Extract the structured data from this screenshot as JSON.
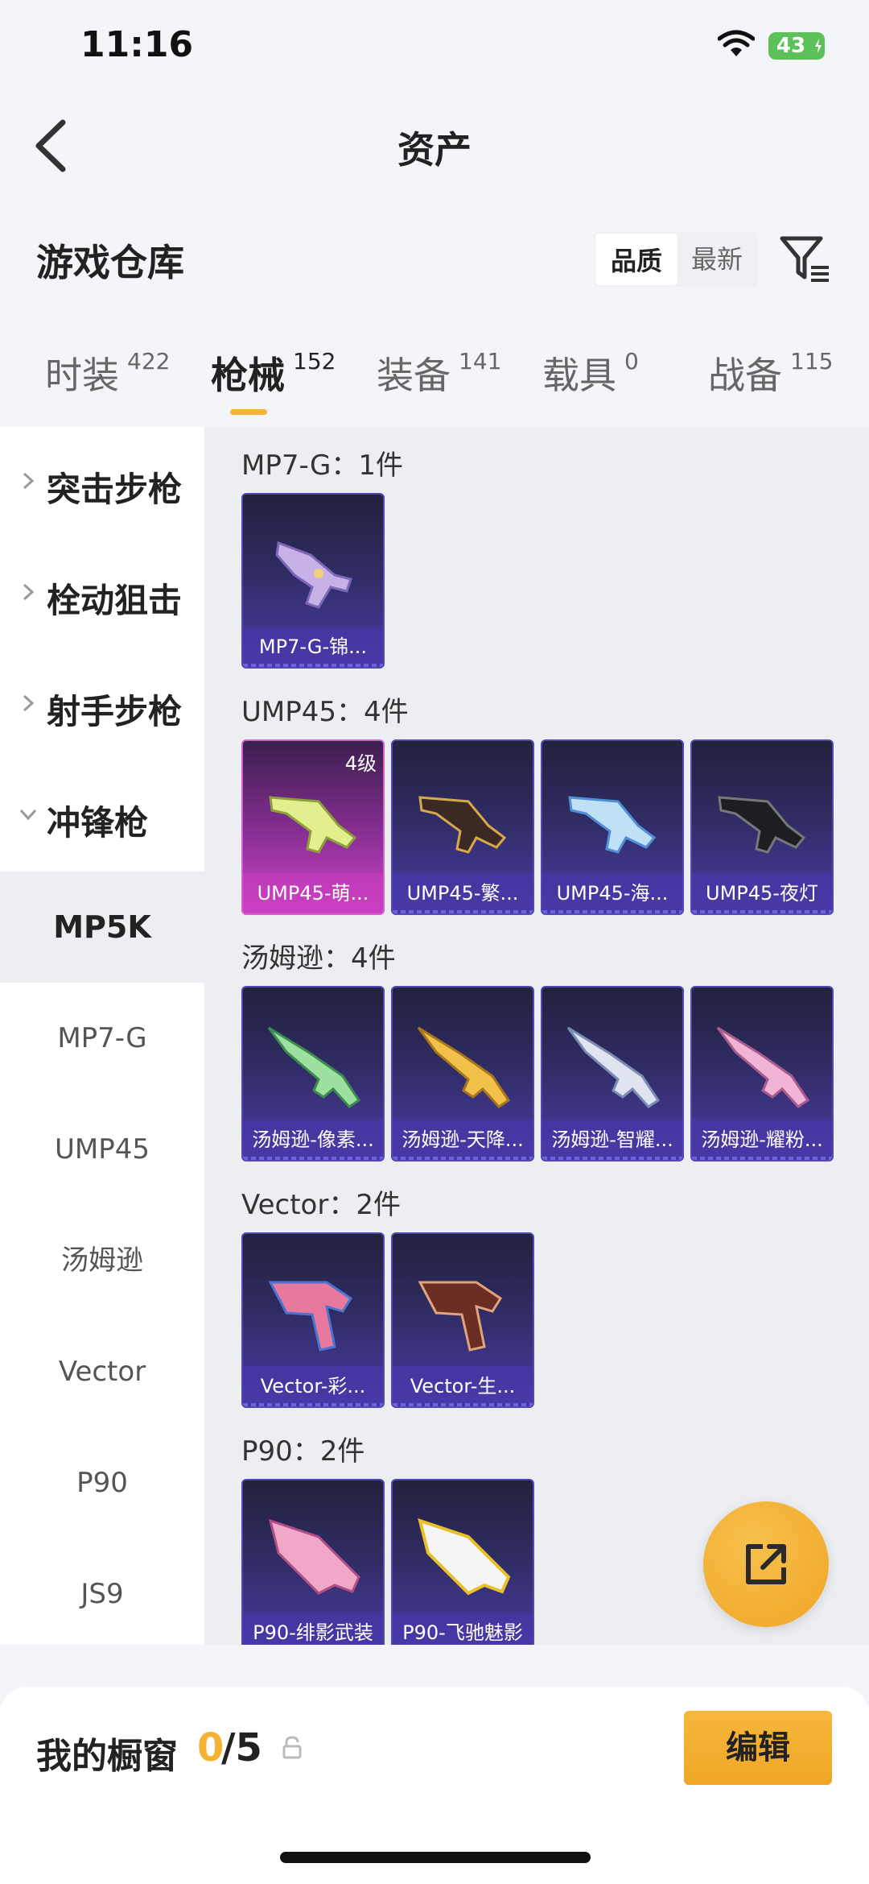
{
  "status": {
    "time": "11:16",
    "battery": "43"
  },
  "header": {
    "title": "资产"
  },
  "warehouse": {
    "title": "游戏仓库",
    "sort_options": [
      "品质",
      "最新"
    ]
  },
  "tabs": [
    {
      "label": "时装",
      "count": "422"
    },
    {
      "label": "枪械",
      "count": "152",
      "active": true
    },
    {
      "label": "装备",
      "count": "141"
    },
    {
      "label": "载具",
      "count": "0"
    },
    {
      "label": "战备",
      "count": "115"
    }
  ],
  "sidebar": {
    "categories": [
      "突击步枪",
      "栓动狙击",
      "射手步枪",
      "冲锋枪"
    ],
    "subitems": [
      "MP5K",
      "MP7-G",
      "UMP45",
      "汤姆逊",
      "Vector",
      "P90",
      "JS9"
    ],
    "active_subitem": "MP5K"
  },
  "groups": [
    {
      "title": "MP7-G：1件",
      "items": [
        {
          "name": "MP7-G-锦..."
        }
      ]
    },
    {
      "title": "UMP45：4件",
      "items": [
        {
          "name": "UMP45-萌...",
          "level": "4级",
          "rarity": "pink"
        },
        {
          "name": "UMP45-繁..."
        },
        {
          "name": "UMP45-海..."
        },
        {
          "name": "UMP45-夜灯"
        }
      ]
    },
    {
      "title": "汤姆逊：4件",
      "items": [
        {
          "name": "汤姆逊-像素..."
        },
        {
          "name": "汤姆逊-天降..."
        },
        {
          "name": "汤姆逊-智耀..."
        },
        {
          "name": "汤姆逊-耀粉..."
        }
      ]
    },
    {
      "title": "Vector：2件",
      "items": [
        {
          "name": "Vector-彩..."
        },
        {
          "name": "Vector-生..."
        }
      ]
    },
    {
      "title": "P90：2件",
      "items": [
        {
          "name": "P90-绯影武装"
        },
        {
          "name": "P90-飞驰魅影"
        }
      ]
    }
  ],
  "showcase": {
    "label": "我的橱窗",
    "current": "0",
    "total": "/5"
  },
  "actions": {
    "edit_label": "编辑"
  },
  "colors": {
    "accent": "#f4b334",
    "card_blue": "#2f2c63",
    "card_pink": "#d146c9"
  }
}
